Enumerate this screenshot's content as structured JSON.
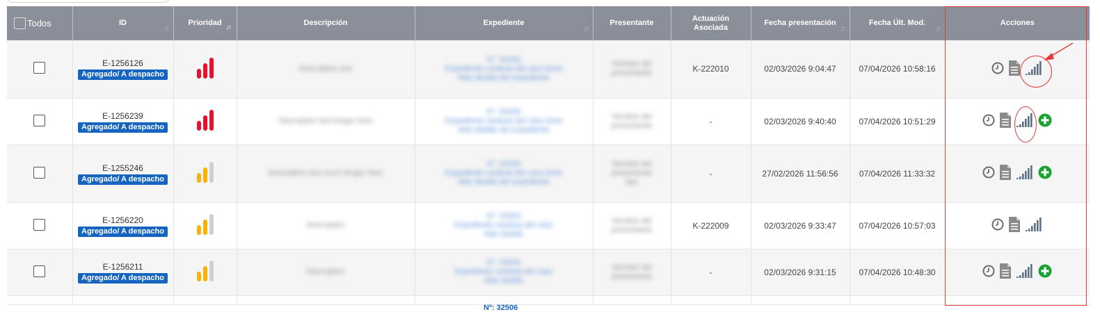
{
  "header": {
    "select_all": "Todos",
    "columns": [
      "ID",
      "Prioridad",
      "Descripción",
      "Expediente",
      "Presentante",
      "Actuación Asociada",
      "Fecha presentación",
      "Fecha Últ. Mod.",
      "Acciones"
    ]
  },
  "rows": [
    {
      "id": "E-1256126",
      "status": "Agregado/ A despacho",
      "priority": "high",
      "desc": "Description text",
      "exp": [
        "N°: 00000",
        "Expediente carátula del caso texto",
        "Más detalle del expediente"
      ],
      "presenter": [
        "Nombre del",
        "presentante"
      ],
      "actuacion": "K-222010",
      "fecha_presentacion": "02/03/2026 9:04:47",
      "fecha_mod": "07/04/2026 10:58:16",
      "has_add": false
    },
    {
      "id": "E-1256239",
      "status": "Agregado/ A despacho",
      "priority": "high",
      "desc": "Description text longer here",
      "exp": [
        "N°: 00000",
        "Expediente carátula del caso texto",
        "Más detalle del expediente"
      ],
      "presenter": [
        "Nombre del",
        "presentante"
      ],
      "actuacion": "-",
      "fecha_presentacion": "02/03/2026 9:40:40",
      "fecha_mod": "07/04/2026 10:51:29",
      "has_add": true
    },
    {
      "id": "E-1255246",
      "status": "Agregado/ A despacho",
      "priority": "medium",
      "desc": "Description text much longer here",
      "exp": [
        "N°: 00000",
        "Expediente carátula del caso texto",
        "Más detalle del expediente"
      ],
      "presenter": [
        "Nombre del",
        "presentante",
        "tipo"
      ],
      "actuacion": "-",
      "fecha_presentacion": "27/02/2026 11:56:56",
      "fecha_mod": "07/04/2026 11:33:32",
      "has_add": true
    },
    {
      "id": "E-1256220",
      "status": "Agregado/ A despacho",
      "priority": "medium",
      "desc": "Description",
      "exp": [
        "N°: 00000",
        "Expediente carátula del caso",
        "Más detalle"
      ],
      "presenter": [
        "Nombre del",
        "presentante"
      ],
      "actuacion": "K-222009",
      "fecha_presentacion": "02/03/2026 9:33:47",
      "fecha_mod": "07/04/2026 10:57:03",
      "has_add": false
    },
    {
      "id": "E-1256211",
      "status": "Agregado/ A despacho",
      "priority": "medium",
      "desc": "Description",
      "exp": [
        "N°: 00000",
        "Expediente carátula del caso",
        "Más detalle"
      ],
      "presenter": [
        "Nombre del",
        "presentante"
      ],
      "actuacion": "-",
      "fecha_presentacion": "02/03/2026 9:31:15",
      "fecha_mod": "07/04/2026 10:48:30",
      "has_add": true
    }
  ],
  "partial_row_text": "Nº: 32506",
  "colors": {
    "header_bg": "#8a8f99",
    "badge": "#1565c0",
    "priority_high": "#e8102e",
    "priority_med": "#f6b20b",
    "priority_off": "#cfcfcf",
    "action_icon": "#6b6b6b",
    "signal_icon": "#5b6f86",
    "add_icon": "#1aa332",
    "annotation": "#e53935"
  },
  "icons": {
    "history": "clock-icon",
    "document": "document-icon",
    "signal": "signal-bars-icon",
    "add": "add-circle-icon"
  }
}
